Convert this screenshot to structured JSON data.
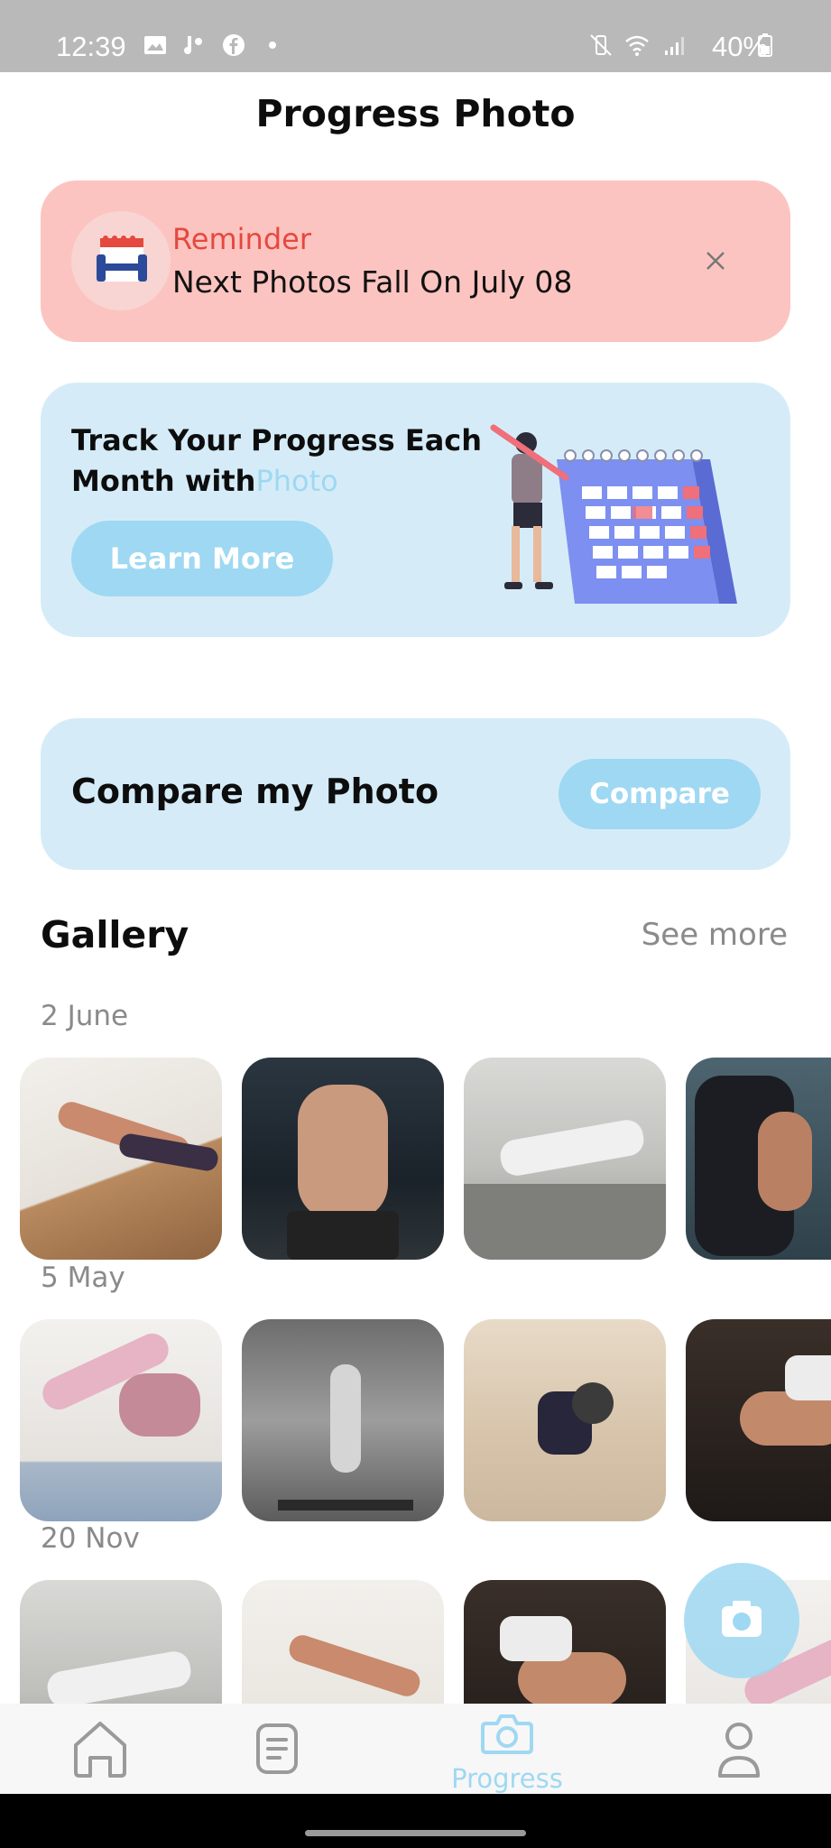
{
  "status_bar": {
    "time": "12:39",
    "battery": "40%",
    "left_icons": [
      "image-icon",
      "voicemail-icon",
      "facebook-icon",
      "dot-icon"
    ],
    "right_icons": [
      "vibrate-icon",
      "wifi-icon",
      "signal-icon",
      "battery-icon"
    ]
  },
  "header": {
    "title": "Progress Photo"
  },
  "reminder": {
    "label": "Reminder",
    "text": "Next Photos Fall On July 08",
    "icon": "calendar-dumbbell-icon",
    "close_icon": "close-icon"
  },
  "track_card": {
    "title_main": "Track Your Progress Each Month with",
    "title_accent": "Photo",
    "button_label": "Learn More",
    "illustration": "person-calendar-illustration"
  },
  "compare_card": {
    "title": "Compare my Photo",
    "button_label": "Compare"
  },
  "gallery": {
    "title": "Gallery",
    "see_more": "See more",
    "groups": [
      {
        "date": "2 June"
      },
      {
        "date": "5 May"
      },
      {
        "date": "20 Nov"
      }
    ]
  },
  "fab": {
    "icon": "camera-icon"
  },
  "bottom_nav": {
    "items": [
      {
        "icon": "home-icon",
        "label": ""
      },
      {
        "icon": "list-icon",
        "label": ""
      },
      {
        "icon": "camera-icon",
        "label": "Progress",
        "active": true
      },
      {
        "icon": "user-icon",
        "label": ""
      }
    ]
  },
  "colors": {
    "accent": "#9fd8f2",
    "reminder_bg": "#fcc4c0",
    "reminder_label": "#e5483f",
    "card_bg": "#d5ecf8",
    "muted_text": "#8a8a8a"
  }
}
